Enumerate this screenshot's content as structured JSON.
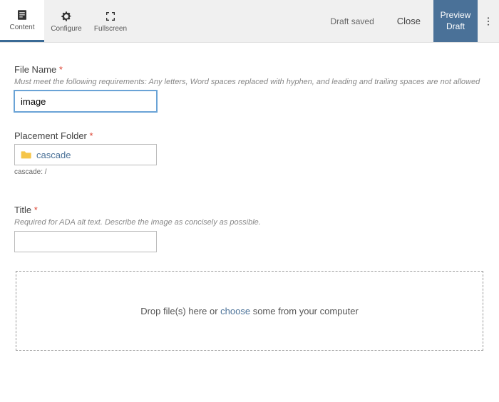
{
  "toolbar": {
    "tabs": {
      "content": "Content",
      "configure": "Configure",
      "fullscreen": "Fullscreen"
    },
    "status": "Draft saved",
    "close": "Close",
    "preview": "Preview Draft"
  },
  "form": {
    "filename": {
      "label": "File Name",
      "help": "Must meet the following requirements: Any letters, Word spaces replaced with hyphen, and leading and trailing spaces are not allowed",
      "value": "image"
    },
    "folder": {
      "label": "Placement Folder",
      "value": "cascade",
      "path": "cascade: /"
    },
    "title_field": {
      "label": "Title",
      "help": "Required for ADA alt text. Describe the image as concisely as possible.",
      "value": ""
    },
    "dropzone": {
      "prefix": "Drop file(s) here or ",
      "choose": "choose",
      "suffix": " some from your computer"
    }
  }
}
